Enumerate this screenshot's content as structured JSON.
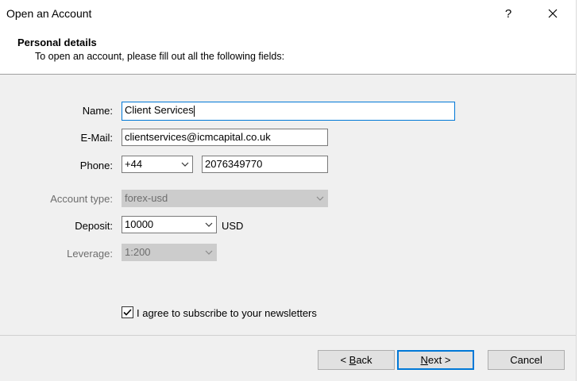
{
  "window": {
    "title": "Open an Account",
    "help_label": "?"
  },
  "header": {
    "title": "Personal details",
    "subtitle": "To open an account, please fill out all the following fields:"
  },
  "form": {
    "name": {
      "label": "Name:",
      "value": "Client Services"
    },
    "email": {
      "label": "E-Mail:",
      "value": "clientservices@icmcapital.co.uk"
    },
    "phone": {
      "label": "Phone:",
      "country_code": "+44",
      "number": "2076349770"
    },
    "account_type": {
      "label": "Account type:",
      "value": "forex-usd"
    },
    "deposit": {
      "label": "Deposit:",
      "value": "10000",
      "currency": "USD"
    },
    "leverage": {
      "label": "Leverage:",
      "value": "1:200"
    },
    "newsletter": {
      "label": "I agree to subscribe to your newsletters",
      "checked": true
    }
  },
  "buttons": {
    "back": {
      "prefix": "< ",
      "mnemonic": "B",
      "rest": "ack"
    },
    "next": {
      "mnemonic": "N",
      "rest": "ext >"
    },
    "cancel": "Cancel"
  },
  "colors": {
    "focus_border": "#0078d7",
    "dialog_bg": "#f0f0f0",
    "disabled_bg": "#cccccc"
  }
}
